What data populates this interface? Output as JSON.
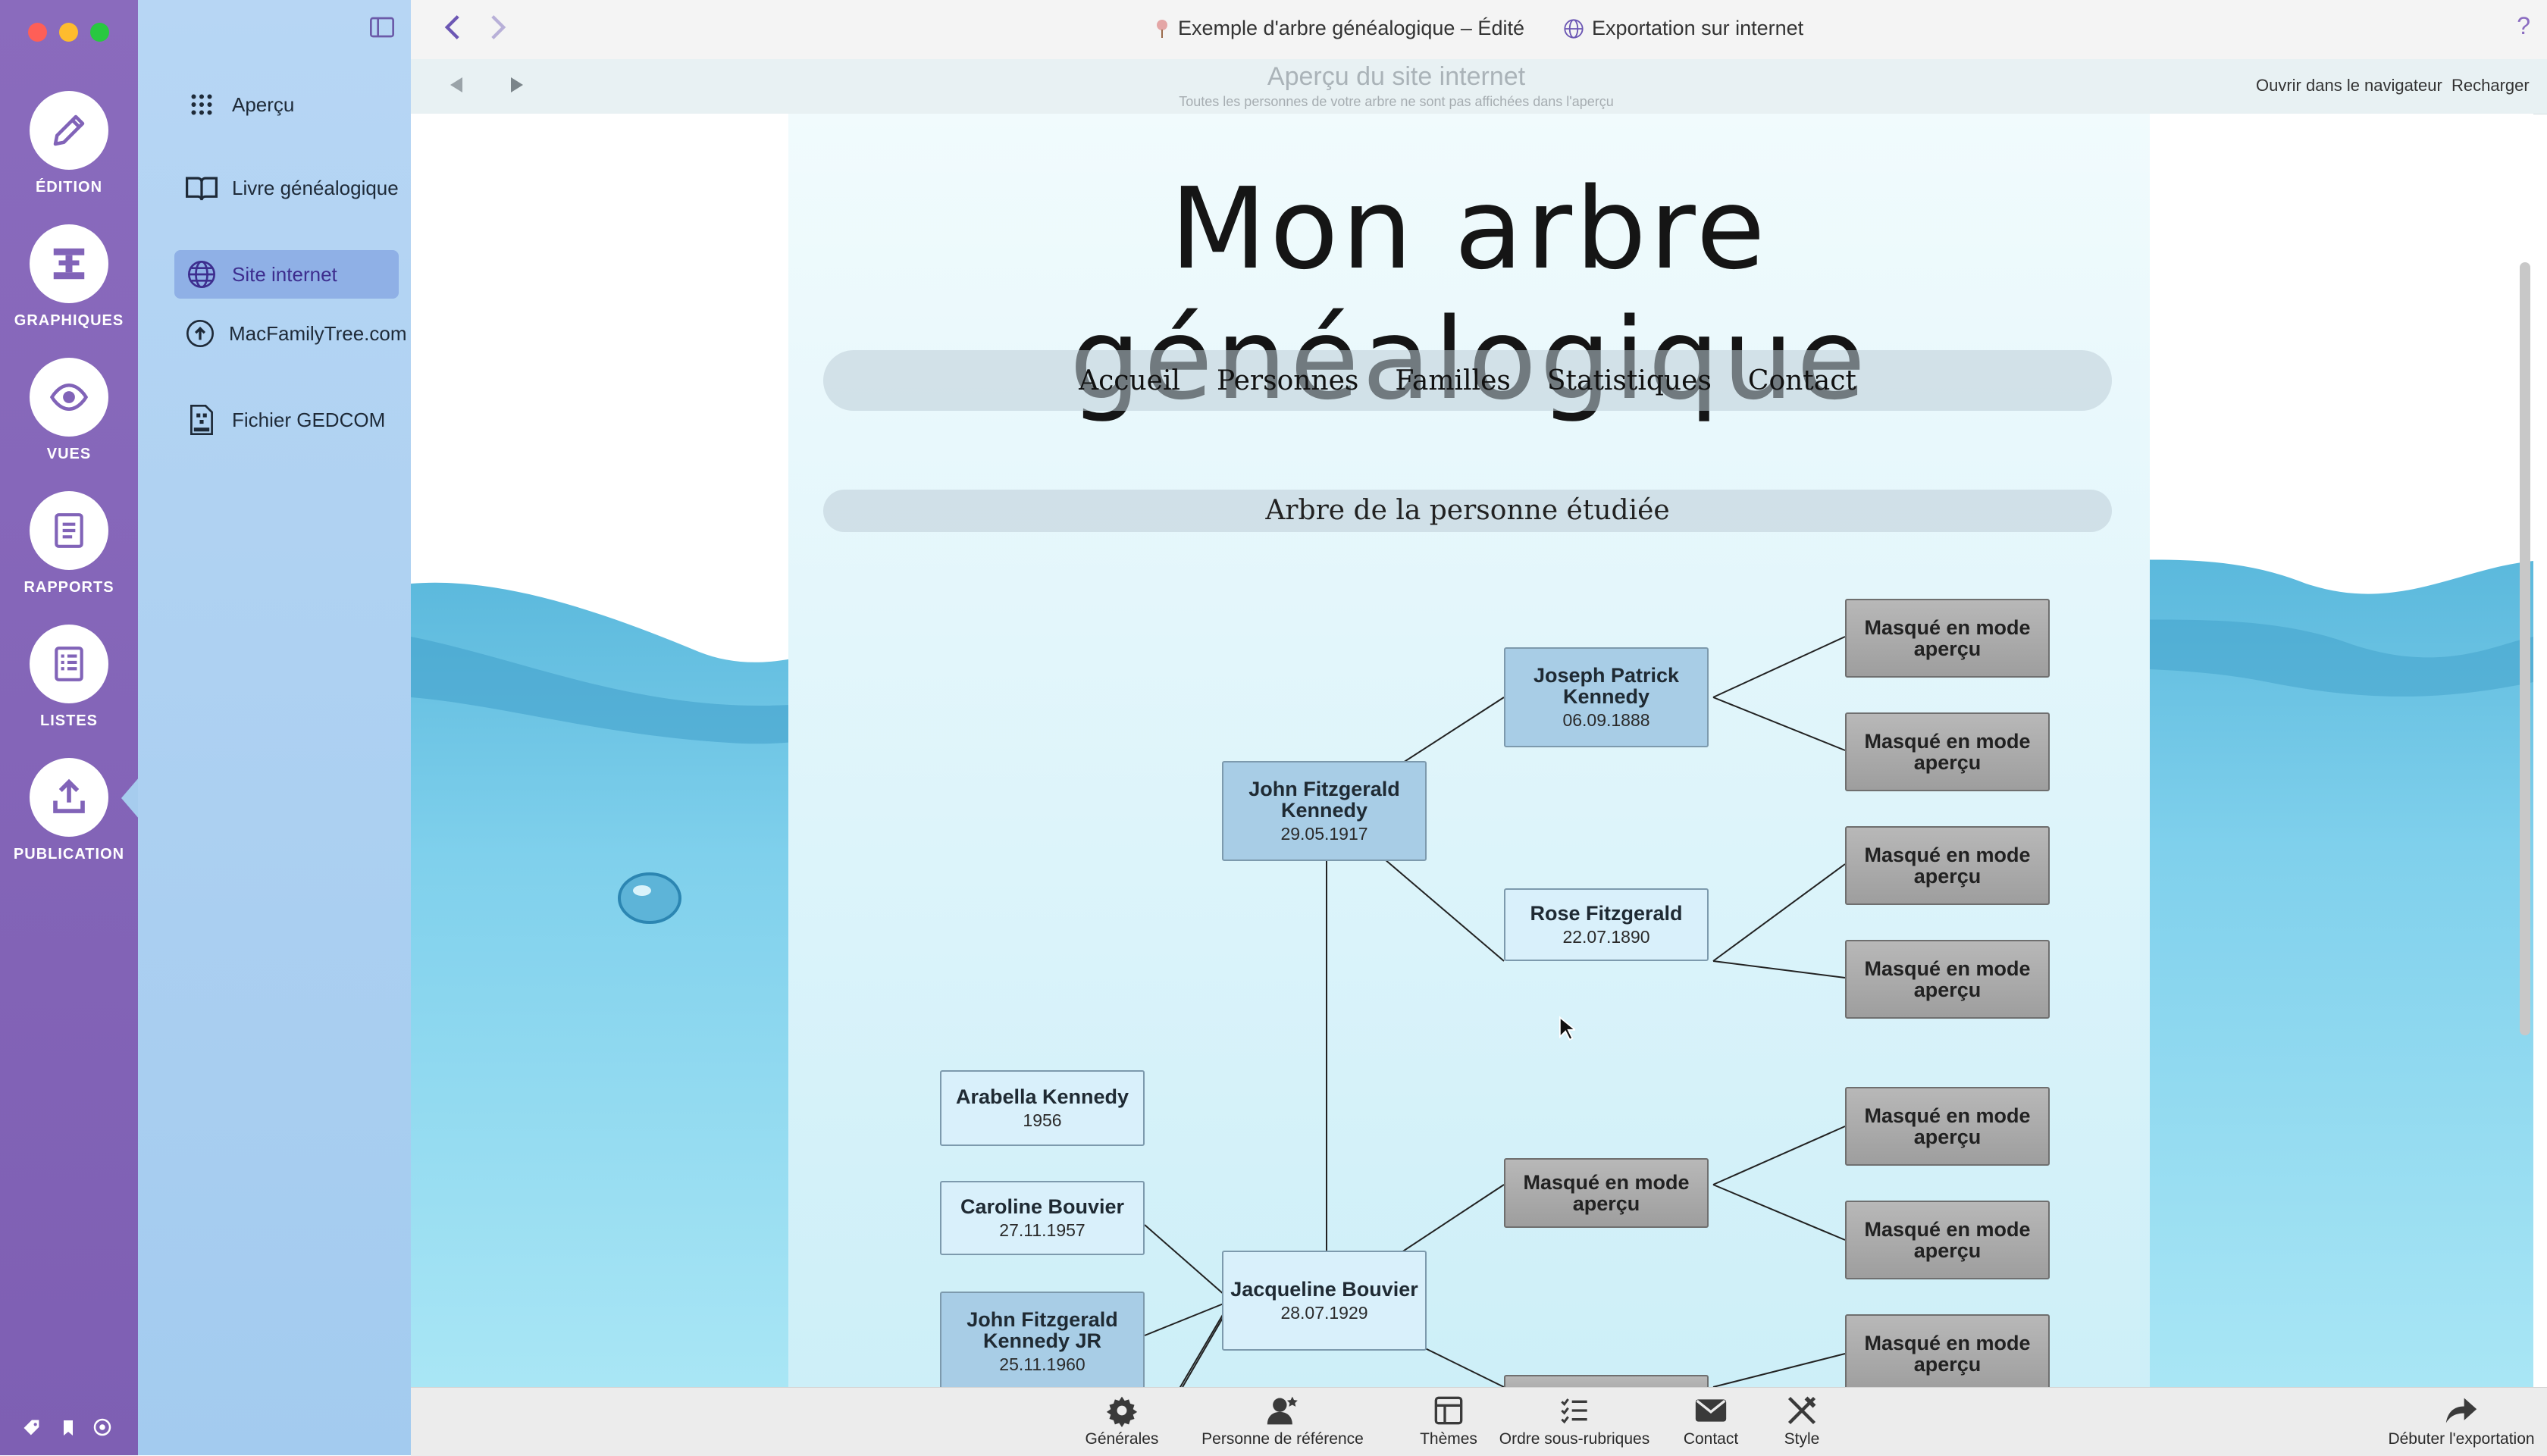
{
  "rail": {
    "items": [
      {
        "label": "ÉDITION",
        "icon": "pencil-icon"
      },
      {
        "label": "GRAPHIQUES",
        "icon": "chart-icon"
      },
      {
        "label": "VUES",
        "icon": "eye-icon"
      },
      {
        "label": "RAPPORTS",
        "icon": "report-icon"
      },
      {
        "label": "LISTES",
        "icon": "list-icon"
      },
      {
        "label": "PUBLICATION",
        "icon": "upload-icon"
      }
    ],
    "active": "PUBLICATION",
    "colors": {
      "background": "#7e5fb3",
      "traffic_red": "#fe5f57",
      "traffic_yellow": "#febc2e",
      "traffic_green": "#28c840"
    }
  },
  "sidebar": {
    "items": [
      {
        "label": "Aperçu",
        "icon": "grid-icon"
      },
      {
        "label": "Livre généalogique",
        "icon": "book-icon"
      },
      {
        "label": "Site internet",
        "icon": "globe-icon",
        "active": true
      },
      {
        "label": "MacFamilyTree.com",
        "icon": "globe-upload-icon"
      },
      {
        "label": "Fichier GEDCOM",
        "icon": "gedcom-file-icon"
      }
    ]
  },
  "titlebar": {
    "document": "Exemple d'arbre généalogique – Édité",
    "tab": "Exportation sur internet",
    "help": "?"
  },
  "preview_bar": {
    "title": "Aperçu du site internet",
    "subtitle": "Toutes les personnes de votre arbre ne sont pas affichées dans l'aperçu",
    "open_browser": "Ouvrir dans le navigateur",
    "reload": "Recharger"
  },
  "site": {
    "title": "Mon arbre généalogique",
    "nav": [
      "Accueil",
      "Personnes",
      "Familles",
      "Statistiques",
      "Contact"
    ],
    "section_title": "Arbre de la personne étudiée",
    "masked_label": "Masqué en mode aperçu",
    "people": {
      "john_fk": {
        "name": "John Fitzgerald Kennedy",
        "date": "29.05.1917"
      },
      "joseph": {
        "name": "Joseph Patrick Kennedy",
        "date": "06.09.1888"
      },
      "rose": {
        "name": "Rose Fitzgerald",
        "date": "22.07.1890"
      },
      "jacqueline": {
        "name": "Jacqueline Bouvier",
        "date": "28.07.1929"
      },
      "arabella": {
        "name": "Arabella Kennedy",
        "date": "1956"
      },
      "caroline": {
        "name": "Caroline Bouvier",
        "date": "27.11.1957"
      },
      "john_jr": {
        "name": "John Fitzgerald Kennedy JR",
        "date": "25.11.1960"
      }
    }
  },
  "toolbar": {
    "items": [
      {
        "label": "Générales",
        "icon": "gear-icon"
      },
      {
        "label": "Personne de référence",
        "icon": "person-star-icon"
      },
      {
        "label": "Thèmes",
        "icon": "themes-icon"
      },
      {
        "label": "Ordre sous-rubriques",
        "icon": "ordered-list-icon"
      },
      {
        "label": "Contact",
        "icon": "envelope-icon"
      },
      {
        "label": "Style",
        "icon": "style-tools-icon"
      }
    ],
    "start_export": "Débuter l'exportation"
  }
}
